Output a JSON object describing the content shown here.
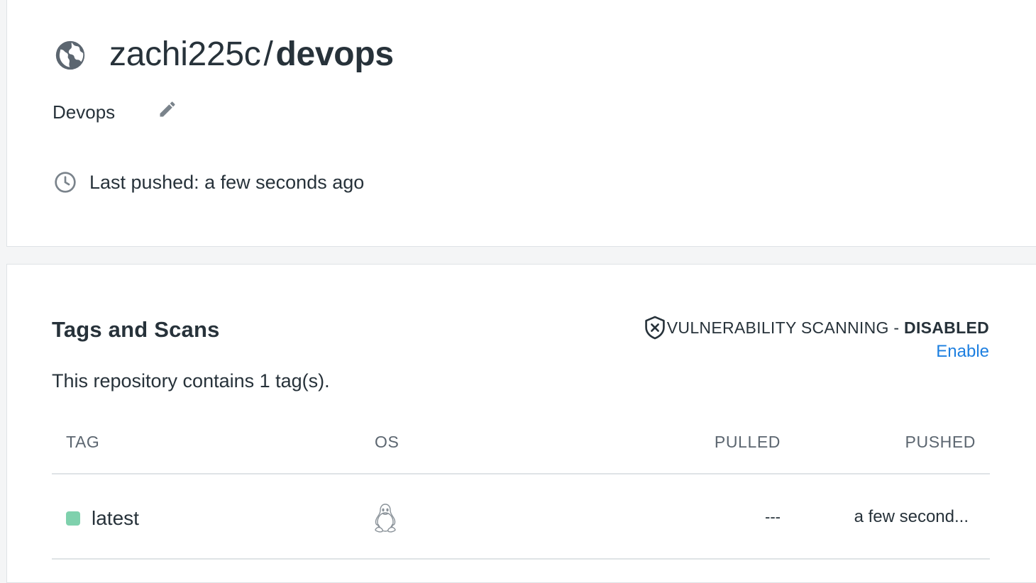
{
  "repo": {
    "visibility_icon": "globe-icon",
    "namespace": "zachi225c",
    "separator": "/",
    "name": "devops",
    "description": "Devops",
    "edit_icon": "pencil-icon",
    "last_pushed_icon": "clock-icon",
    "last_pushed": "Last pushed: a few seconds ago"
  },
  "tags_section": {
    "title": "Tags and Scans",
    "count_text": "This repository contains 1 tag(s).",
    "vuln_icon": "shield-x-icon",
    "vuln_label": "VULNERABILITY SCANNING - ",
    "vuln_state": "DISABLED",
    "enable_label": "Enable",
    "columns": [
      "TAG",
      "OS",
      "PULLED",
      "PUSHED"
    ],
    "rows": [
      {
        "tag": "latest",
        "status_color": "#7fd1ad",
        "os_icon": "linux-icon",
        "pulled": "---",
        "pushed": "a few second..."
      }
    ]
  },
  "colors": {
    "accent_link": "#1d7fe0",
    "text": "#27323a",
    "muted": "#5c6670",
    "border": "#dfe3e6"
  }
}
